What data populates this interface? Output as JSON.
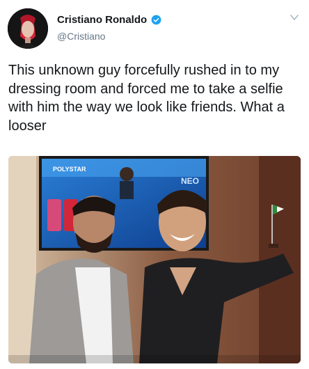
{
  "tweet": {
    "display_name": "Cristiano Ronaldo",
    "handle": "@Cristiano",
    "text": "This unknown guy forcefully rushed in to my dressing room and forced me to take a selfie with him the way we look like friends. What a looser",
    "verified": true,
    "avatar_icon": "profile-avatar",
    "menu_icon": "chevron-down-icon",
    "colors": {
      "verified_badge": "#1da1f2",
      "handle": "#657786",
      "text": "#14171a"
    }
  },
  "photo": {
    "tv_logo_text": "POLYSTAR",
    "tv_side_text": "NEO"
  }
}
